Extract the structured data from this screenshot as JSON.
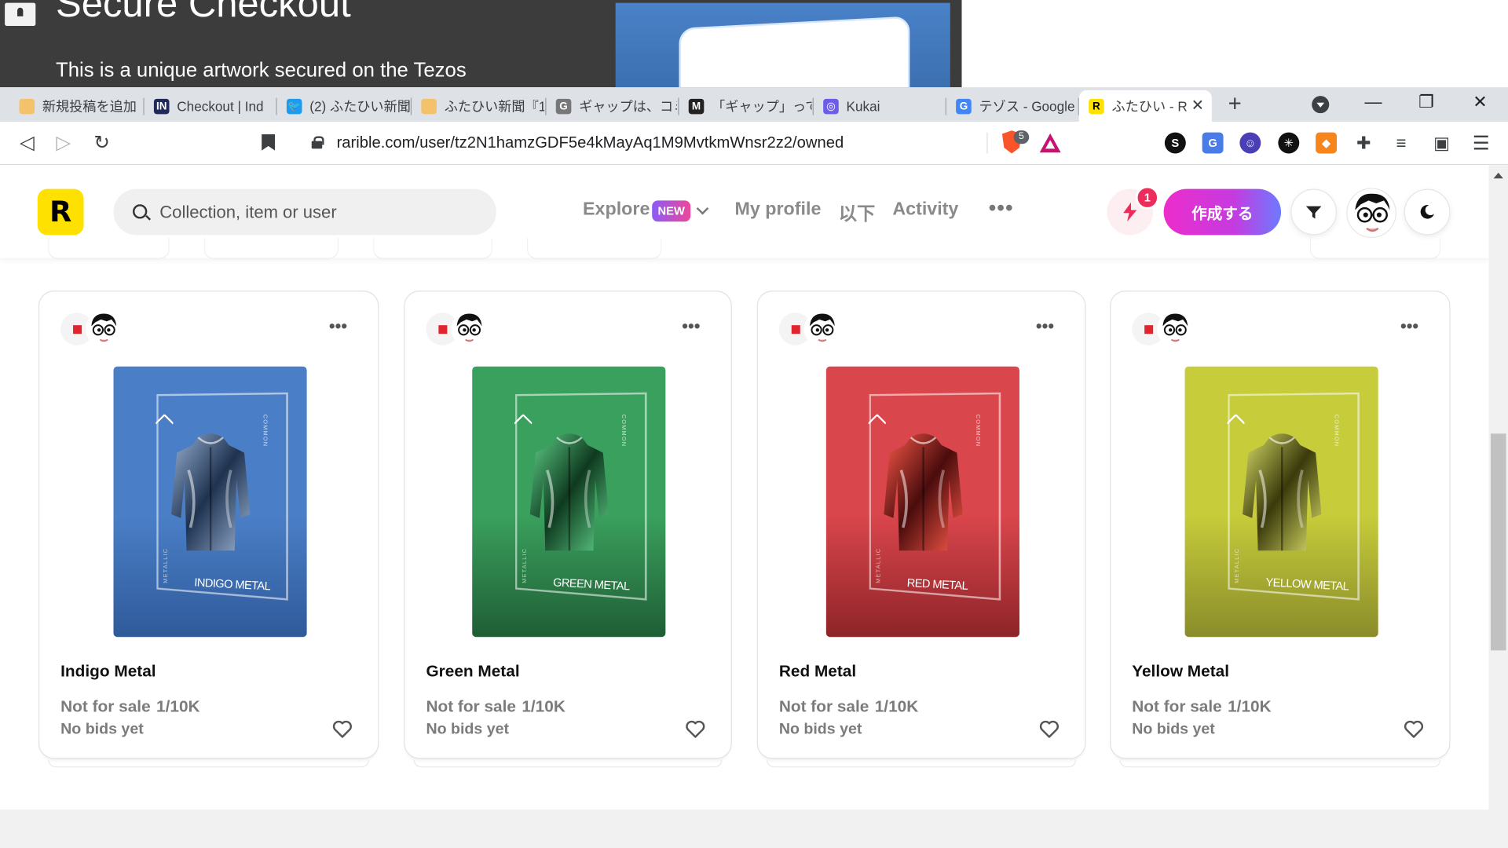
{
  "background_page": {
    "title": "Secure Checkout",
    "subtitle": "This is a unique artwork secured on the Tezos"
  },
  "tabs": [
    {
      "label": "新規投稿を追加",
      "favicon": "#f3c26b",
      "glyph": ""
    },
    {
      "label": "Checkout | Ind",
      "favicon": "#1f2a5a",
      "glyph": "IN"
    },
    {
      "label": "(2) ふたひい新聞",
      "favicon": "#1d9bf0",
      "glyph": "🐦"
    },
    {
      "label": "ふたひい新聞『1",
      "favicon": "#f3c26b",
      "glyph": ""
    },
    {
      "label": "ギャップは、コミュ",
      "favicon": "#777777",
      "glyph": "G"
    },
    {
      "label": "「ギャップ」ってど",
      "favicon": "#222222",
      "glyph": "M"
    },
    {
      "label": "Kukai",
      "favicon": "#6c5ce7",
      "glyph": "◎"
    },
    {
      "label": "テゾス - Google",
      "favicon": "#4285f4",
      "glyph": "G"
    },
    {
      "label": "ふたひい - R",
      "favicon": "#fee101",
      "glyph": "R"
    }
  ],
  "addressbar": {
    "url": "rarible.com/user/tz2N1hamzGDF5e4kMayAq1M9MvtkmWnsr2z2/owned",
    "brave_shield_count": "5"
  },
  "header": {
    "search_placeholder": "Collection, item or user",
    "nav_explore": "Explore",
    "new_badge": "NEW",
    "nav_my_profile": "My profile",
    "nav_following": "以下",
    "nav_activity": "Activity",
    "more": "•••",
    "notification_count": "1",
    "create_label": "作成する"
  },
  "cards": [
    {
      "title": "Indigo Metal",
      "status": "Not for sale",
      "edition": "1/10K",
      "bids": "No bids yet",
      "art_caption": "INDIGO METAL",
      "color_top": "#4a7fc7",
      "color_bottom": "#2f5a9a",
      "jacket": "#9bb3d6",
      "jacket_dark": "#1f3350"
    },
    {
      "title": "Green Metal",
      "status": "Not for sale",
      "edition": "1/10K",
      "bids": "No bids yet",
      "art_caption": "GREEN METAL",
      "color_top": "#3aa05d",
      "color_bottom": "#1f5e35",
      "jacket": "#5fd38a",
      "jacket_dark": "#0f3a1f"
    },
    {
      "title": "Red Metal",
      "status": "Not for sale",
      "edition": "1/10K",
      "bids": "No bids yet",
      "art_caption": "RED METAL",
      "color_top": "#d9464c",
      "color_bottom": "#8e2428",
      "jacket": "#ff5a4a",
      "jacket_dark": "#4a0c0c"
    },
    {
      "title": "Yellow Metal",
      "status": "Not for sale",
      "edition": "1/10K",
      "bids": "No bids yet",
      "art_caption": "YELLOW METAL",
      "color_top": "#c6cc3a",
      "color_bottom": "#8a8c2a",
      "jacket": "#dfe36a",
      "jacket_dark": "#3a3a0c"
    }
  ],
  "art_labels": {
    "common": "COMMON",
    "metallic": "METALLIC"
  }
}
